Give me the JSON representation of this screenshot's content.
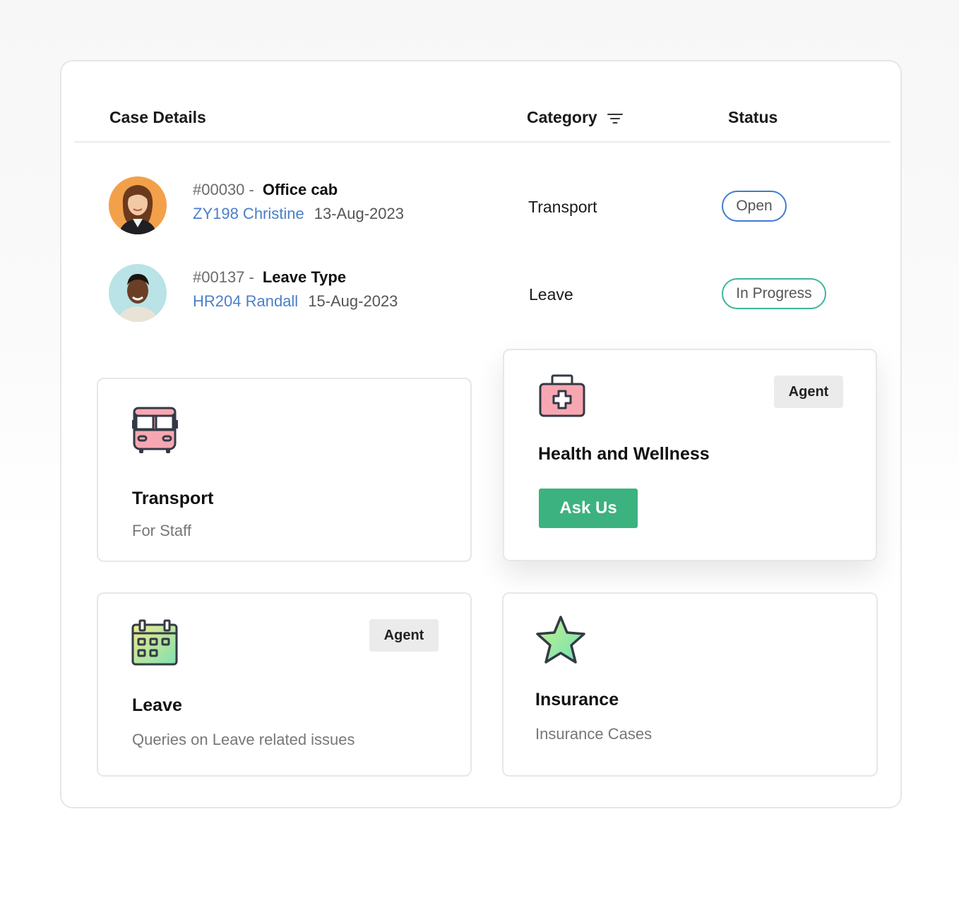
{
  "table": {
    "headers": {
      "case_details": "Case Details",
      "category": "Category",
      "status": "Status"
    },
    "category_filter_icon": "filter-icon",
    "rows": [
      {
        "case_id": "#00030 -",
        "title": "Office cab",
        "user": "ZY198 Christine",
        "date": "13-Aug-2023",
        "category": "Transport",
        "status": "Open",
        "status_color": "#3d7dd4",
        "avatar_color": "#f3a04a"
      },
      {
        "case_id": "#00137 -",
        "title": "Leave Type",
        "user": "HR204 Randall",
        "date": "15-Aug-2023",
        "category": "Leave",
        "status": "In Progress",
        "status_color": "#3db59a",
        "avatar_color": "#b9e3e6"
      }
    ]
  },
  "cards": {
    "transport": {
      "icon": "bus-icon",
      "title": "Transport",
      "subtitle": "For Staff"
    },
    "health": {
      "icon": "first-aid-kit-icon",
      "title": "Health and Wellness",
      "tag": "Agent",
      "button": "Ask Us",
      "button_color": "#3bb27f"
    },
    "leave": {
      "icon": "calendar-icon",
      "title": "Leave",
      "subtitle": "Queries on Leave related issues",
      "tag": "Agent"
    },
    "insurance": {
      "icon": "star-icon",
      "title": "Insurance",
      "subtitle": "Insurance Cases"
    }
  }
}
